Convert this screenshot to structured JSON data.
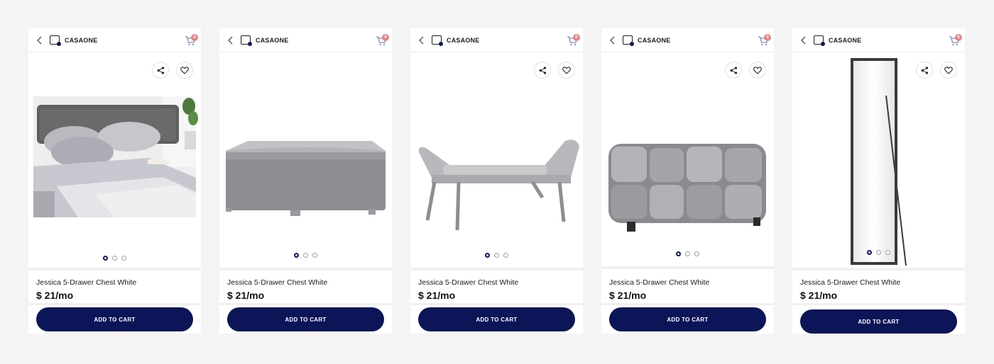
{
  "brand": "CASAONE",
  "cart_count": "0",
  "icons": {
    "back": "chevron-left-icon",
    "logo": "casaone-logo-icon",
    "cart": "shopping-cart-icon",
    "share": "share-icon",
    "favorite": "heart-icon"
  },
  "colors": {
    "background": "#f4f4f4",
    "card": "#ffffff",
    "button": "#0b1557",
    "badge": "#e58686",
    "dot_active": "#0f1a5c"
  },
  "products": [
    {
      "name": "Jessica 5-Drawer Chest White",
      "price": "$ 21/mo",
      "button_label": "ADD TO CART",
      "image": "bed-with-grey-linens",
      "active_dot": 1,
      "dot_count": 3
    },
    {
      "name": "Jessica 5-Drawer Chest White",
      "price": "$ 21/mo",
      "button_label": "ADD TO CART",
      "image": "grey-square-ottoman",
      "active_dot": 1,
      "dot_count": 3
    },
    {
      "name": "Jessica 5-Drawer Chest White",
      "price": "$ 21/mo",
      "button_label": "ADD TO CART",
      "image": "grey-tufted-bench",
      "active_dot": 1,
      "dot_count": 3
    },
    {
      "name": "Jessica 5-Drawer Chest White",
      "price": "$ 21/mo",
      "button_label": "ADD TO CART",
      "image": "woven-velvet-ottoman",
      "active_dot": 1,
      "dot_count": 3
    },
    {
      "name": "Jessica 5-Drawer Chest White",
      "price": "$ 21/mo",
      "button_label": "ADD TO CART",
      "image": "standing-floor-mirror",
      "active_dot": 1,
      "dot_count": 3
    }
  ]
}
